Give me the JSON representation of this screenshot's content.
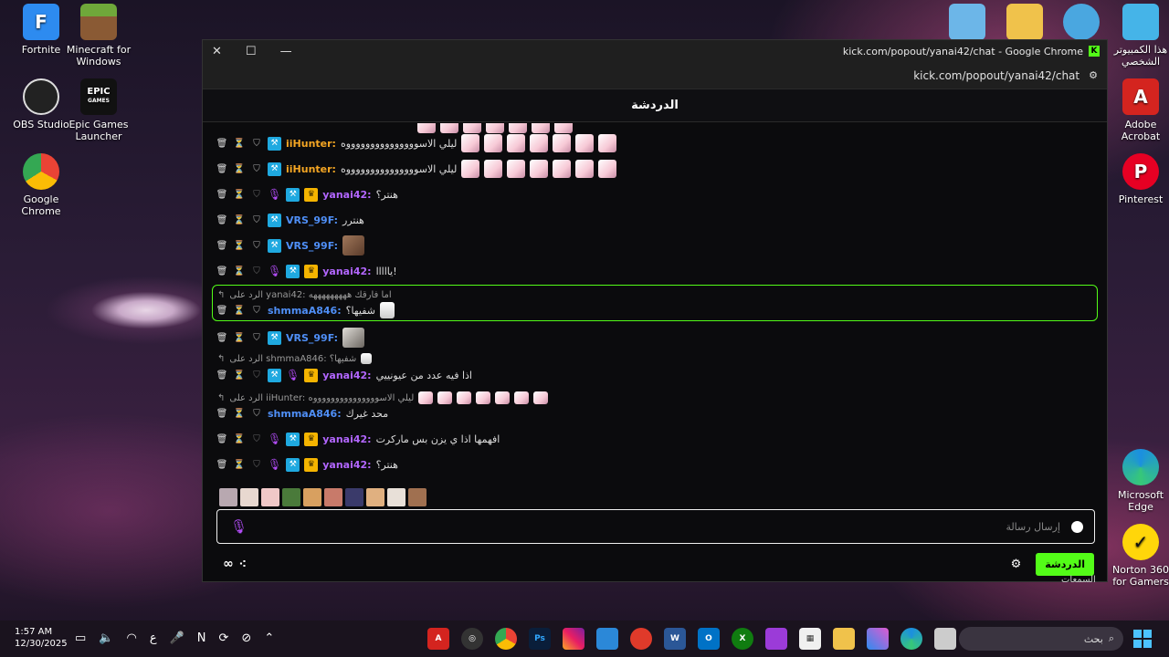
{
  "desktop_icons": {
    "fortnite": "Fortnite",
    "minecraft": "Minecraft for Windows",
    "obs": "OBS Studio",
    "epic": "Epic Games Launcher",
    "chrome": "Google Chrome",
    "this_pc": "هذا الكمبيوتر الشخصي",
    "acrobat": "Adobe Acrobat",
    "pinterest": "Pinterest",
    "edge": "Microsoft Edge",
    "norton": "Norton 360 for Gamers",
    "epic_logo": "EPIC",
    "epic_sub": "GAMES"
  },
  "window": {
    "title": "kick.com/popout/yanai42/chat - Google Chrome",
    "url": "kick.com/popout/yanai42/chat",
    "close": "✕",
    "maximize": "☐",
    "minimize": "—"
  },
  "chat": {
    "header": "الدردشة",
    "reply_prefix": "الرد على",
    "messages": {
      "m1_user": "iiHunter:",
      "m1_text": "ليلي الاسوووووووووووووووه",
      "m2_user": "iiHunter:",
      "m2_text": "ليلي الاسوووووووووووووووه",
      "m3_user": "yanai42:",
      "m3_text": "هنتر؟",
      "m4_user": "VRS_99F:",
      "m4_text": "هنترر",
      "m5_user": "VRS_99F:",
      "m6_user": "yanai42:",
      "m6_text": "يااااا!",
      "m7_reply": "الرد على yanai42: اما فارقك هههههههههه",
      "m7_user": "shmmaA846:",
      "m7_text": "شفيها؟",
      "m8_user": "VRS_99F:",
      "m9_reply": "الرد على shmmaA846: شفيها؟",
      "m9_user": "yanai42:",
      "m9_text": "اذا فيه عدد من عيونييي",
      "m10_reply": "الرد على iiHunter: ليلي الاسوووووووووووووووه",
      "m10_user": "shmmaA846:",
      "m10_text": "محد غيرك",
      "m11_user": "yanai42:",
      "m11_text": "افهمها اذا ي يزن بس ماركرت",
      "m12_user": "yanai42:",
      "m12_text": "هنتر؟"
    },
    "input_placeholder": "إرسال رسالة",
    "send_button": "الدردشة",
    "footer_text": "السمعات"
  },
  "taskbar": {
    "time": "1:57 AM",
    "date": "12/30/2025",
    "search_placeholder": "بحث",
    "lang": "ع",
    "app_ps": "Ps"
  },
  "colors": {
    "kick_green": "#53fc18",
    "mod_blue": "#1fa9e0",
    "vip_gold": "#f5b400",
    "mic_purple": "#b14cf5"
  }
}
